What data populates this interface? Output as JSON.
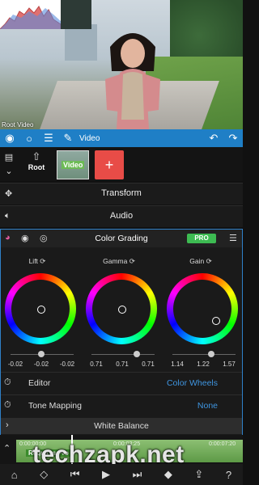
{
  "preview": {
    "label": "Root Video"
  },
  "toolbar": {
    "eye_icon": "eye-icon",
    "circle_icon": "circle-icon",
    "menu_icon": "menu-icon",
    "title": "Video",
    "undo_icon": "undo-icon",
    "redo_icon": "redo-icon",
    "accent": "#1f7fc6"
  },
  "layers": {
    "root_label": "Root",
    "video_label": "Video",
    "add_label": "+"
  },
  "menu": {
    "transform": "Transform",
    "audio": "Audio"
  },
  "color_grading": {
    "title": "Color Grading",
    "pro_badge": "PRO",
    "wheels": [
      {
        "label": "Lift",
        "values": [
          "-0.02",
          "-0.02",
          "-0.02"
        ]
      },
      {
        "label": "Gamma",
        "values": [
          "0.71",
          "0.71",
          "0.71"
        ]
      },
      {
        "label": "Gain",
        "values": [
          "1.14",
          "1.22",
          "1.57"
        ]
      }
    ],
    "editor_label": "Editor",
    "editor_value": "Color Wheels",
    "tone_mapping_label": "Tone Mapping",
    "tone_mapping_value": "None",
    "white_balance_label": "White Balance"
  },
  "timeline": {
    "time_start": "0:00:00:00",
    "time_mid": "0:00:03:25",
    "time_end": "0:00:07:20",
    "clip_label": "Requires Pro"
  },
  "watermark": "techzapk.net"
}
